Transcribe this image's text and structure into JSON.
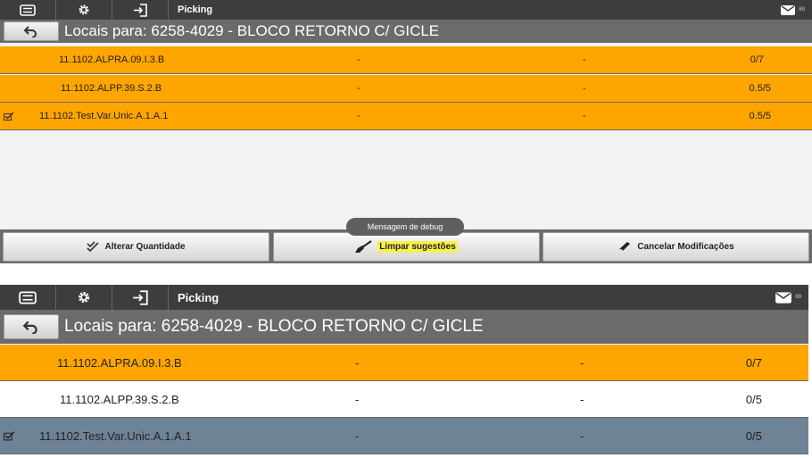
{
  "colors": {
    "row_orange": "#ffa500",
    "row_white": "#ffffff",
    "row_selected_gray": "#6f8396",
    "topbar": "#3d3d3d",
    "header": "#6b6b6b",
    "highlight": "#f6f24a"
  },
  "icons": [
    "menu-icon",
    "gear-icon",
    "sign-in-icon",
    "mail-icon",
    "back-arrow-icon",
    "checkbox-icon",
    "double-check-icon",
    "broom-icon",
    "eraser-icon"
  ],
  "panel1": {
    "topbar": {
      "title": "Picking",
      "msg_count": "69"
    },
    "header": {
      "title": "Locais para: 6258-4029 - BLOCO RETORNO C/ GICLE"
    },
    "rows": [
      {
        "location": "11.1102.ALPRA.09.I.3.B",
        "col2": "-",
        "col3": "-",
        "qty": "0/7",
        "checked": false,
        "bg": "orange"
      },
      {
        "location": "11.1102.ALPP.39.S.2.B",
        "col2": "-",
        "col3": "-",
        "qty": "0.5/5",
        "checked": false,
        "bg": "orange"
      },
      {
        "location": "11.1102.Test.Var.Unic.A.1.A.1",
        "col2": "-",
        "col3": "-",
        "qty": "0.5/5",
        "checked": true,
        "bg": "orange"
      }
    ],
    "toast": "Mensagem de debug",
    "buttons": {
      "alter": "Alterar Quantidade",
      "clear": "Limpar sugestões",
      "cancel": "Cancelar Modificações"
    }
  },
  "panel2": {
    "topbar": {
      "title": "Picking",
      "msg_count": "69"
    },
    "header": {
      "title": "Locais para: 6258-4029 - BLOCO RETORNO C/ GICLE"
    },
    "rows": [
      {
        "location": "11.1102.ALPRA.09.I.3.B",
        "col2": "-",
        "col3": "-",
        "qty": "0/7",
        "checked": false,
        "bg": "orange"
      },
      {
        "location": "11.1102.ALPP.39.S.2.B",
        "col2": "-",
        "col3": "-",
        "qty": "0/5",
        "checked": false,
        "bg": "white"
      },
      {
        "location": "11.1102.Test.Var.Unic.A.1.A.1",
        "col2": "-",
        "col3": "-",
        "qty": "0/5",
        "checked": true,
        "bg": "gray"
      }
    ]
  }
}
